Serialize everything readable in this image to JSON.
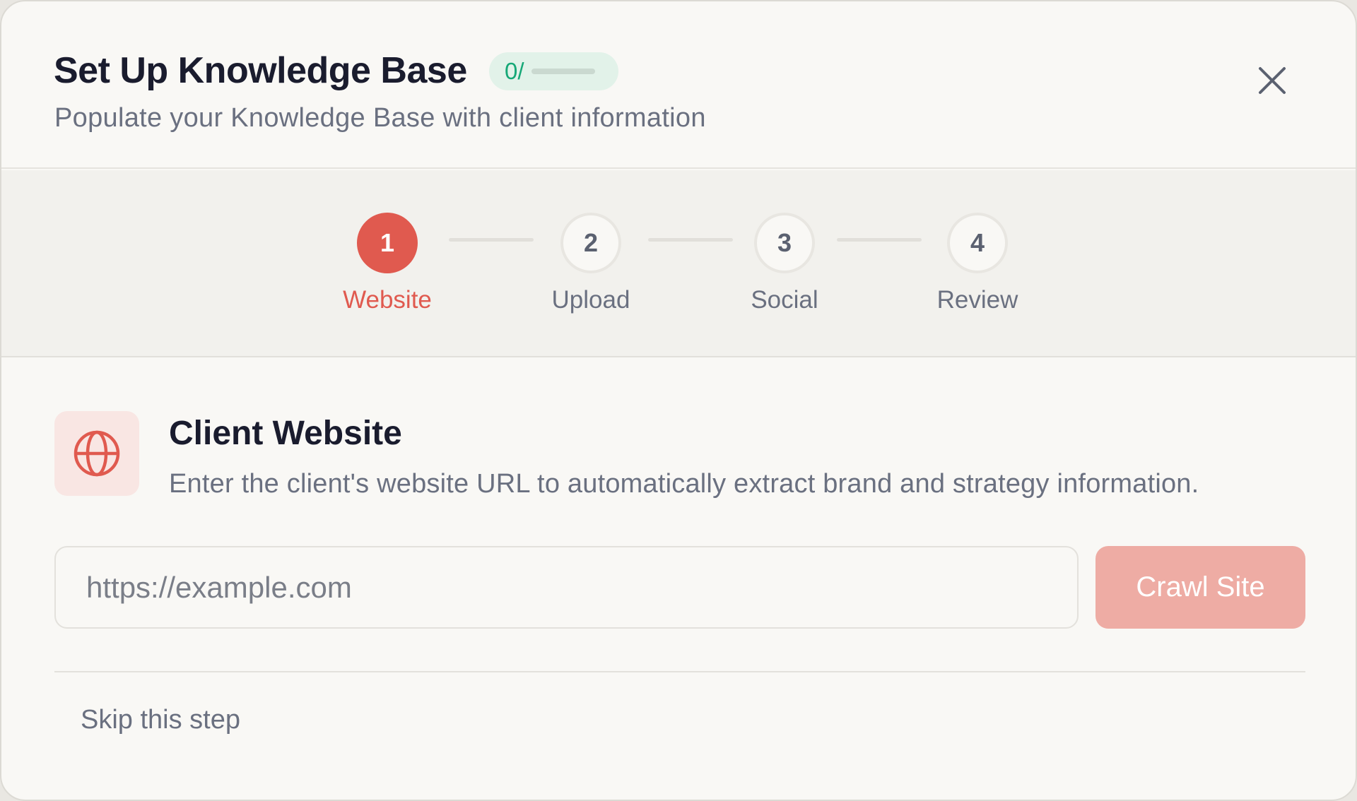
{
  "header": {
    "title": "Set Up Knowledge Base",
    "progress_badge": {
      "text": "0/",
      "progress": 0,
      "color": "#16a877"
    },
    "subtitle": "Populate your Knowledge Base with client information",
    "close_icon": "close-icon"
  },
  "stepper": {
    "active_index": 0,
    "accent_color": "#e05a4f",
    "steps": [
      {
        "number": "1",
        "label": "Website"
      },
      {
        "number": "2",
        "label": "Upload"
      },
      {
        "number": "3",
        "label": "Social"
      },
      {
        "number": "4",
        "label": "Review"
      }
    ]
  },
  "section": {
    "icon": "globe-icon",
    "title": "Client Website",
    "description": "Enter the client's website URL to automatically extract brand and strategy information."
  },
  "url_field": {
    "value": "",
    "placeholder": "https://example.com"
  },
  "crawl_button": {
    "label": "Crawl Site"
  },
  "skip_link": {
    "label": "Skip this step"
  }
}
